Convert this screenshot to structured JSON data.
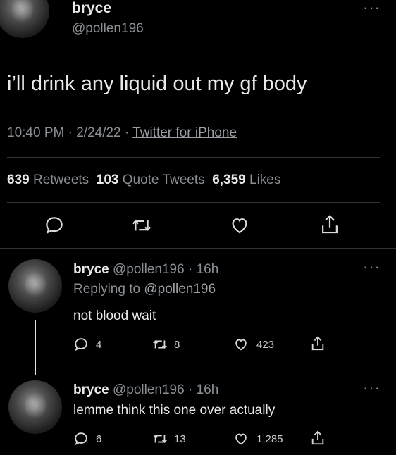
{
  "main_tweet": {
    "display_name": "bryce",
    "handle": "@pollen196",
    "text": "i’ll drink any liquid out my gf body",
    "time": "10:40 PM",
    "date": "2/24/22",
    "source": "Twitter for iPhone",
    "retweets_count": "639",
    "retweets_label": "Retweets",
    "quotes_count": "103",
    "quotes_label": "Quote Tweets",
    "likes_count": "6,359",
    "likes_label": "Likes"
  },
  "replies": [
    {
      "display_name": "bryce",
      "handle_time": "@pollen196 · 16h",
      "replying_prefix": "Replying to",
      "replying_to": "@pollen196",
      "text": "not blood wait",
      "reply_count": "4",
      "retweet_count": "8",
      "like_count": "423"
    },
    {
      "display_name": "bryce",
      "handle_time": "@pollen196 · 16h",
      "text": "lemme think this one over actually",
      "reply_count": "6",
      "retweet_count": "13",
      "like_count": "1,285"
    }
  ],
  "colors": {
    "background": "#000000",
    "text": "#e7e9ea",
    "muted": "#8b9095",
    "divider": "#2f3336"
  },
  "separator": "·",
  "more_icon_text": "···"
}
